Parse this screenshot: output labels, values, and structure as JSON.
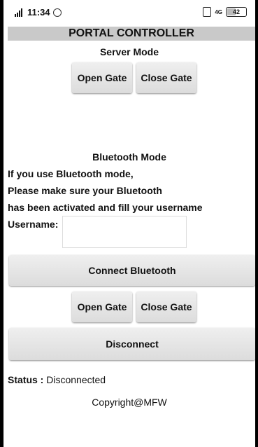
{
  "statusbar": {
    "network_label": "4G",
    "time": "11:34",
    "net_type": "4G",
    "battery": "42",
    "battery_level": 0.42,
    "icons": [
      "signal-icon",
      "whatsapp-icon",
      "vibrate-icon",
      "battery-icon"
    ]
  },
  "app": {
    "title": "PORTAL CONTROLLER"
  },
  "server": {
    "heading": "Server Mode",
    "open_label": "Open Gate",
    "close_label": "Close Gate"
  },
  "bluetooth": {
    "heading": "Bluetooth Mode",
    "instructions": [
      "If you use Bluetooth mode,",
      "Please make sure your Bluetooth",
      "has been activated and fill your username"
    ],
    "username_label": "Username:",
    "username_value": "",
    "connect_label": "Connect Bluetooth",
    "open_label": "Open Gate",
    "close_label": "Close Gate",
    "disconnect_label": "Disconnect"
  },
  "status": {
    "label": "Status :",
    "value": "Disconnected"
  },
  "footer": {
    "copyright": "Copyright@MFW"
  }
}
